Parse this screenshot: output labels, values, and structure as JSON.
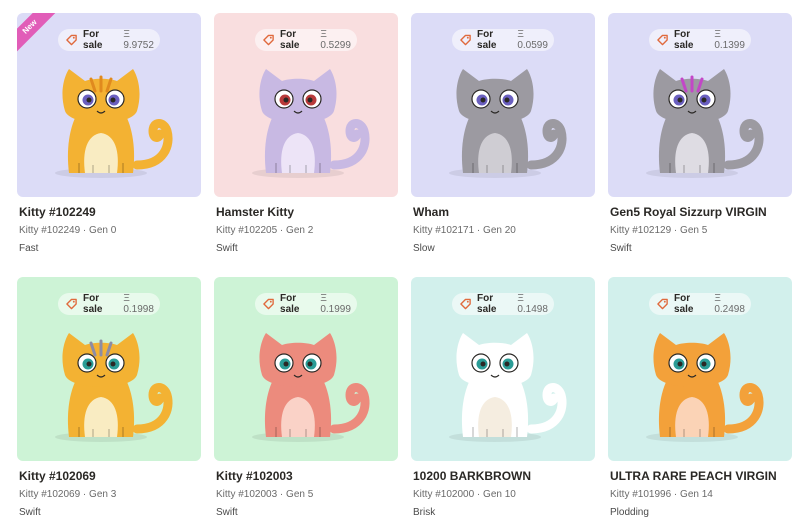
{
  "sale_label": "For sale",
  "currency_symbol": "Ξ",
  "cards": [
    {
      "name": "Kitty #102249",
      "subtitle": "Kitty #102249 · Gen 0",
      "speed": "Fast",
      "price": "Ξ 9.9752",
      "bg": "#dcdcf7",
      "body": "#f3b233",
      "belly": "#f9ecc2",
      "eye": "#6a5fbf",
      "stripes": "#e08a1e",
      "new_label": "New"
    },
    {
      "name": "Hamster Kitty",
      "subtitle": "Kitty #102205 · Gen 2",
      "speed": "Swift",
      "price": "Ξ 0.5299",
      "bg": "#f9dedf",
      "body": "#c8b9e3",
      "belly": "#ede4f7",
      "eye": "#b83a3a",
      "stripes": ""
    },
    {
      "name": "Wham",
      "subtitle": "Kitty #102171 · Gen 20",
      "speed": "Slow",
      "price": "Ξ 0.0599",
      "bg": "#dcdcf7",
      "body": "#9c9aa1",
      "belly": "#cfcdd3",
      "eye": "#6a5fbf",
      "stripes": ""
    },
    {
      "name": "Gen5 Royal Sizzurp VIRGIN",
      "subtitle": "Kitty #102129 · Gen 5",
      "speed": "Swift",
      "price": "Ξ 0.1399",
      "bg": "#dcdcf7",
      "body": "#9c9aa1",
      "belly": "#dedce3",
      "eye": "#6a5fbf",
      "stripes": "#c347c7"
    },
    {
      "name": "Kitty #102069",
      "subtitle": "Kitty #102069 · Gen 3",
      "speed": "Swift",
      "price": "Ξ 0.1998",
      "bg": "#cdf3d6",
      "body": "#f3b233",
      "belly": "#f9ecc2",
      "eye": "#2a9c96",
      "stripes": "#8d8ca5"
    },
    {
      "name": "Kitty #102003",
      "subtitle": "Kitty #102003 · Gen 5",
      "speed": "Swift",
      "price": "Ξ 0.1999",
      "bg": "#cdf3d6",
      "body": "#ec8b7d",
      "belly": "#fad2c7",
      "eye": "#2a9c96",
      "stripes": ""
    },
    {
      "name": "10200 BARKBROWN",
      "subtitle": "Kitty #102000 · Gen 10",
      "speed": "Brisk",
      "price": "Ξ 0.1498",
      "bg": "#d2f0ec",
      "body": "#ffffff",
      "belly": "#f5ede0",
      "eye": "#2a9c96",
      "stripes": ""
    },
    {
      "name": "ULTRA RARE PEACH VIRGIN",
      "subtitle": "Kitty #101996 · Gen 14",
      "speed": "Plodding",
      "price": "Ξ 0.2498",
      "bg": "#d2f0ec",
      "body": "#f3a13a",
      "belly": "#fbd3b6",
      "eye": "#2a9c96",
      "stripes": ""
    }
  ]
}
